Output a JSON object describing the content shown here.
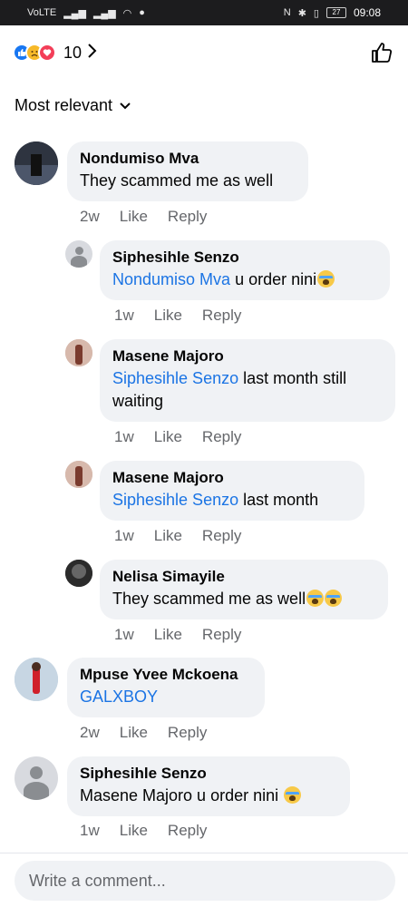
{
  "status_bar": {
    "time": "09:08",
    "battery": "27"
  },
  "reactions": {
    "count": "10",
    "types": [
      "like-icon",
      "sad-icon",
      "love-icon"
    ]
  },
  "sort": {
    "label": "Most relevant"
  },
  "comments": [
    {
      "name": "Nondumiso Mva",
      "mention": "",
      "text": "They scammed me as well",
      "time": "2w",
      "like": "Like",
      "reply": "Reply"
    },
    {
      "name": "Siphesihle Senzo",
      "mention": "Nondumiso Mva",
      "text": " u order nini",
      "time": "1w",
      "like": "Like",
      "reply": "Reply"
    },
    {
      "name": "Masene Majoro",
      "mention": "Siphesihle Senzo",
      "text": " last month still waiting",
      "time": "1w",
      "like": "Like",
      "reply": "Reply"
    },
    {
      "name": "Masene Majoro",
      "mention": "Siphesihle Senzo",
      "text": " last month",
      "time": "1w",
      "like": "Like",
      "reply": "Reply"
    },
    {
      "name": "Nelisa Simayile",
      "mention": "",
      "text": "They scammed me as well",
      "time": "1w",
      "like": "Like",
      "reply": "Reply"
    },
    {
      "name": "Mpuse Yvee Mckoena",
      "mention": "GALXBOY",
      "text": "",
      "time": "2w",
      "like": "Like",
      "reply": "Reply"
    },
    {
      "name": "Siphesihle Senzo",
      "mention": "",
      "text": "Masene Majoro u order nini ",
      "time": "1w",
      "like": "Like",
      "reply": "Reply"
    }
  ],
  "composer": {
    "placeholder": "Write a comment..."
  }
}
